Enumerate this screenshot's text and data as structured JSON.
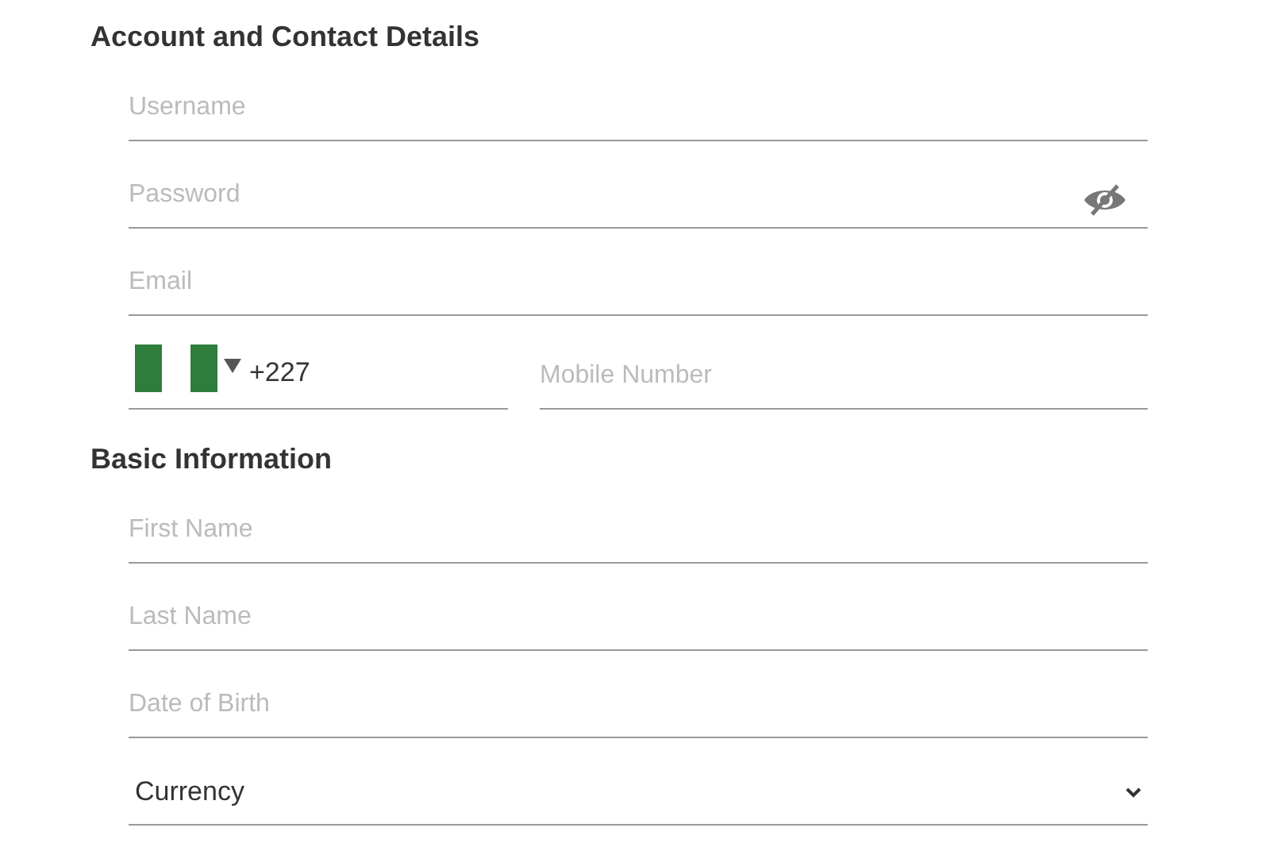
{
  "sections": [
    {
      "title": "Account and Contact Details",
      "fields": [
        {
          "kind": "text",
          "placeholder": "Username"
        },
        {
          "kind": "password",
          "placeholder": "Password",
          "revealed": false
        },
        {
          "kind": "text",
          "placeholder": "Email"
        },
        {
          "kind": "phone",
          "dial_code": "+227",
          "placeholder": "Mobile Number"
        }
      ]
    },
    {
      "title": "Basic Information",
      "fields": [
        {
          "kind": "text",
          "placeholder": "First Name"
        },
        {
          "kind": "text",
          "placeholder": "Last Name"
        },
        {
          "kind": "text",
          "placeholder": "Date of Birth"
        },
        {
          "kind": "select",
          "value": "Currency"
        }
      ]
    }
  ]
}
